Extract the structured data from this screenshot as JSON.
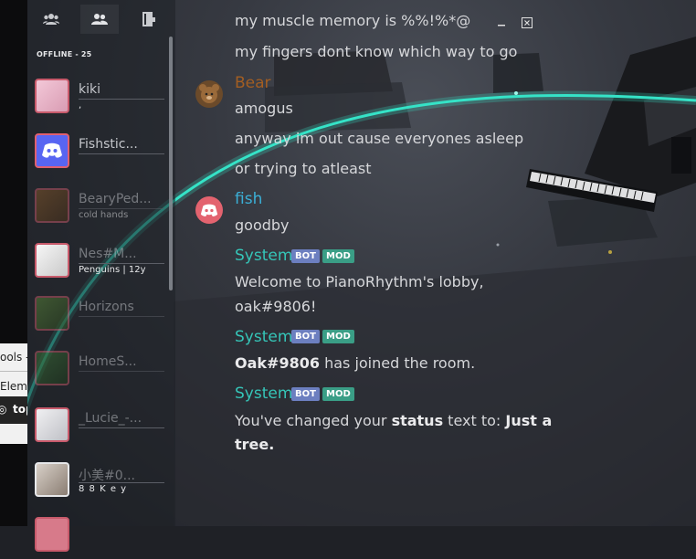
{
  "sidebar": {
    "section_title": "OFFLINE - 25",
    "tabs": [
      {
        "icon": "group-icon",
        "active": false
      },
      {
        "icon": "users-icon",
        "active": true
      },
      {
        "icon": "door-icon",
        "active": false
      }
    ],
    "members": [
      {
        "name": "kiki",
        "status": ","
      },
      {
        "name": "Fishstic...",
        "status": ""
      },
      {
        "name": "BearyPed...",
        "status": "cold hands"
      },
      {
        "name": "Nes#M...",
        "status": "Penguins | 12y"
      },
      {
        "name": "Horizons",
        "status": ""
      },
      {
        "name": "HomeS...",
        "status": ""
      },
      {
        "name": "_Lucie_-...",
        "status": ""
      },
      {
        "name": "小美#0...",
        "status": "8 8 K e y"
      }
    ]
  },
  "devtools": {
    "row1": "ools -",
    "row2": "Eleme",
    "row3": "top"
  },
  "chat": {
    "messages": [
      {
        "text": "my muscle memory is %%!%*@"
      },
      {
        "text": "my fingers dont know which way to go"
      },
      {
        "author": "Bear",
        "text": "amogus"
      },
      {
        "text": "anyway im out cause everyones asleep"
      },
      {
        "text": "or trying to atleast"
      },
      {
        "author": "fish",
        "text": "goodby"
      }
    ],
    "system": {
      "author": "System",
      "badge_bot": "BOT",
      "badge_mod": "MOD",
      "msg1_line1": "Welcome to PianoRhythm's lobby,",
      "msg1_line2": "oak#9806!",
      "msg2_bold": "Oak#9806",
      "msg2_rest": " has joined the room.",
      "msg3_pre": "You've changed your ",
      "msg3_bold1": "status",
      "msg3_mid": " text to: ",
      "msg3_bold2a": "Just a",
      "msg3_bold2b": "tree."
    }
  },
  "colors": {
    "accent_cyan": "#35e3c7",
    "bear_color": "#a35e22",
    "fish_color": "#3bafd6",
    "system_color": "#35c5b8"
  }
}
